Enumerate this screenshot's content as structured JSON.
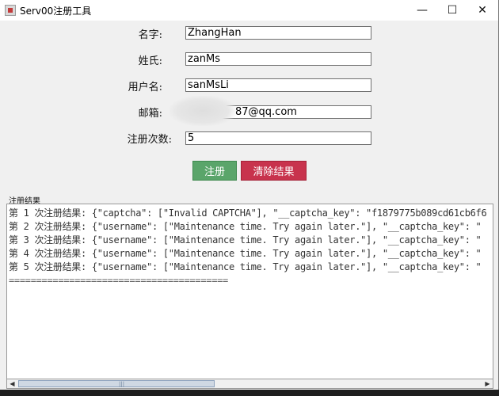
{
  "window": {
    "title": "Serv00注册工具",
    "controls": {
      "minimize": "—",
      "maximize": "☐",
      "close": "✕"
    }
  },
  "form": {
    "fields": [
      {
        "label": "名字:",
        "value": "ZhangHan"
      },
      {
        "label": "姓氏:",
        "value": "zanMs"
      },
      {
        "label": "用户名:",
        "value": "sanMsLi"
      },
      {
        "label": "邮箱:",
        "value": "87@qq.com"
      },
      {
        "label": "注册次数:",
        "value": "5"
      }
    ]
  },
  "buttons": {
    "register": "注册",
    "clear": "清除结果"
  },
  "results": {
    "group_label": "注册结果",
    "lines": [
      "第 1 次注册结果: {\"captcha\": [\"Invalid CAPTCHA\"], \"__captcha_key\": \"f1879775b089cd61cb6f6",
      "第 2 次注册结果: {\"username\": [\"Maintenance time. Try again later.\"], \"__captcha_key\": \"",
      "第 3 次注册结果: {\"username\": [\"Maintenance time. Try again later.\"], \"__captcha_key\": \"",
      "第 4 次注册结果: {\"username\": [\"Maintenance time. Try again later.\"], \"__captcha_key\": \"",
      "第 5 次注册结果: {\"username\": [\"Maintenance time. Try again later.\"], \"__captcha_key\": \""
    ],
    "divider": "========================================"
  },
  "scrollbar": {
    "left_arrow": "◀",
    "right_arrow": "▶",
    "grip": "|||"
  }
}
